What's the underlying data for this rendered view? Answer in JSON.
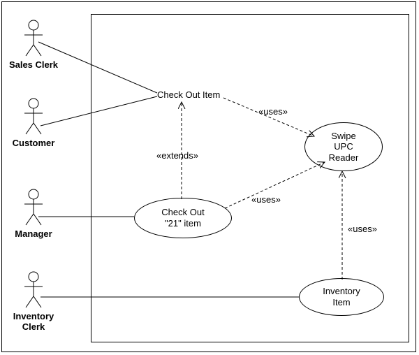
{
  "diagram": {
    "type": "uml-use-case",
    "actors": [
      {
        "id": "sales_clerk",
        "label": "Sales Clerk"
      },
      {
        "id": "customer",
        "label": "Customer"
      },
      {
        "id": "manager",
        "label": "Manager"
      },
      {
        "id": "inventory_clerk",
        "label": "Inventory\nClerk"
      }
    ],
    "usecases": {
      "check_out_item": "Check Out Item",
      "check_out_21": "Check Out\n\"21\" item",
      "swipe_upc": "Swipe\nUPC\nReader",
      "inventory_item": "Inventory\nItem"
    },
    "stereotypes": {
      "extends": "«extends»",
      "uses1": "«uses»",
      "uses2": "«uses»",
      "uses3": "«uses»"
    },
    "relationships": [
      {
        "from": "sales_clerk",
        "to": "check_out_item",
        "type": "association"
      },
      {
        "from": "customer",
        "to": "check_out_item",
        "type": "association"
      },
      {
        "from": "manager",
        "to": "check_out_21",
        "type": "association"
      },
      {
        "from": "inventory_clerk",
        "to": "inventory_item",
        "type": "association"
      },
      {
        "from": "check_out_21",
        "to": "check_out_item",
        "type": "extends"
      },
      {
        "from": "check_out_item",
        "to": "swipe_upc",
        "type": "uses"
      },
      {
        "from": "check_out_21",
        "to": "swipe_upc",
        "type": "uses"
      },
      {
        "from": "inventory_item",
        "to": "swipe_upc",
        "type": "uses"
      }
    ]
  }
}
